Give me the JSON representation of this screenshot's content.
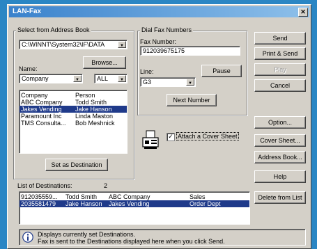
{
  "window": {
    "title": "LAN-Fax",
    "close_glyph": "✕"
  },
  "address_book": {
    "group_label": "Select from Address Book",
    "path_value": "C:\\WINNT\\System32\\IF\\DATA",
    "browse_label": "Browse...",
    "name_label": "Name:",
    "name_field_value": "Company",
    "filter_value": "ALL",
    "entries": [
      {
        "company": "Company",
        "person": "Person",
        "selected": false
      },
      {
        "company": "ABC Company",
        "person": "Todd Smith",
        "selected": false
      },
      {
        "company": "Jakes Vending",
        "person": "Jake Hanson",
        "selected": true
      },
      {
        "company": "Paramount Inc",
        "person": "Linda Maston",
        "selected": false
      },
      {
        "company": "TMS Consulta...",
        "person": "Bob Meshnick",
        "selected": false
      }
    ],
    "set_destination_label": "Set as Destination"
  },
  "dial": {
    "group_label": "Dial Fax Numbers",
    "fax_number_label": "Fax Number:",
    "fax_number_value": "912039675175",
    "line_label": "Line:",
    "line_value": "G3",
    "pause_label": "Pause",
    "next_number_label": "Next Number"
  },
  "cover_sheet": {
    "checkbox_checked": true,
    "checkbox_label": "Attach a Cover Sheet"
  },
  "buttons": {
    "send": "Send",
    "print_send": "Print & Send",
    "play": "Play",
    "cancel": "Cancel",
    "option": "Option...",
    "cover_sheet": "Cover Sheet...",
    "address_book": "Address Book...",
    "help": "Help",
    "delete_from_list": "Delete from List"
  },
  "destinations": {
    "label": "List of Destinations:",
    "count": "2",
    "rows": [
      {
        "number": "912035559...",
        "name": "Todd Smith",
        "company": "ABC Company",
        "dept": "Sales",
        "selected": false
      },
      {
        "number": "2035581479",
        "name": "Jake Hanson",
        "company": "Jakes Vending",
        "dept": "Order Dept",
        "selected": true
      }
    ]
  },
  "status": {
    "icon": "info-icon",
    "line1": "Displays currently set Destinations.",
    "line2": "Fax is sent to the Destinations displayed here when you click Send."
  },
  "colors": {
    "selection": "#1f3a8a",
    "title_start": "#3a82cc",
    "dialog": "#d4d0c8",
    "desktop": "#2a86c4"
  }
}
